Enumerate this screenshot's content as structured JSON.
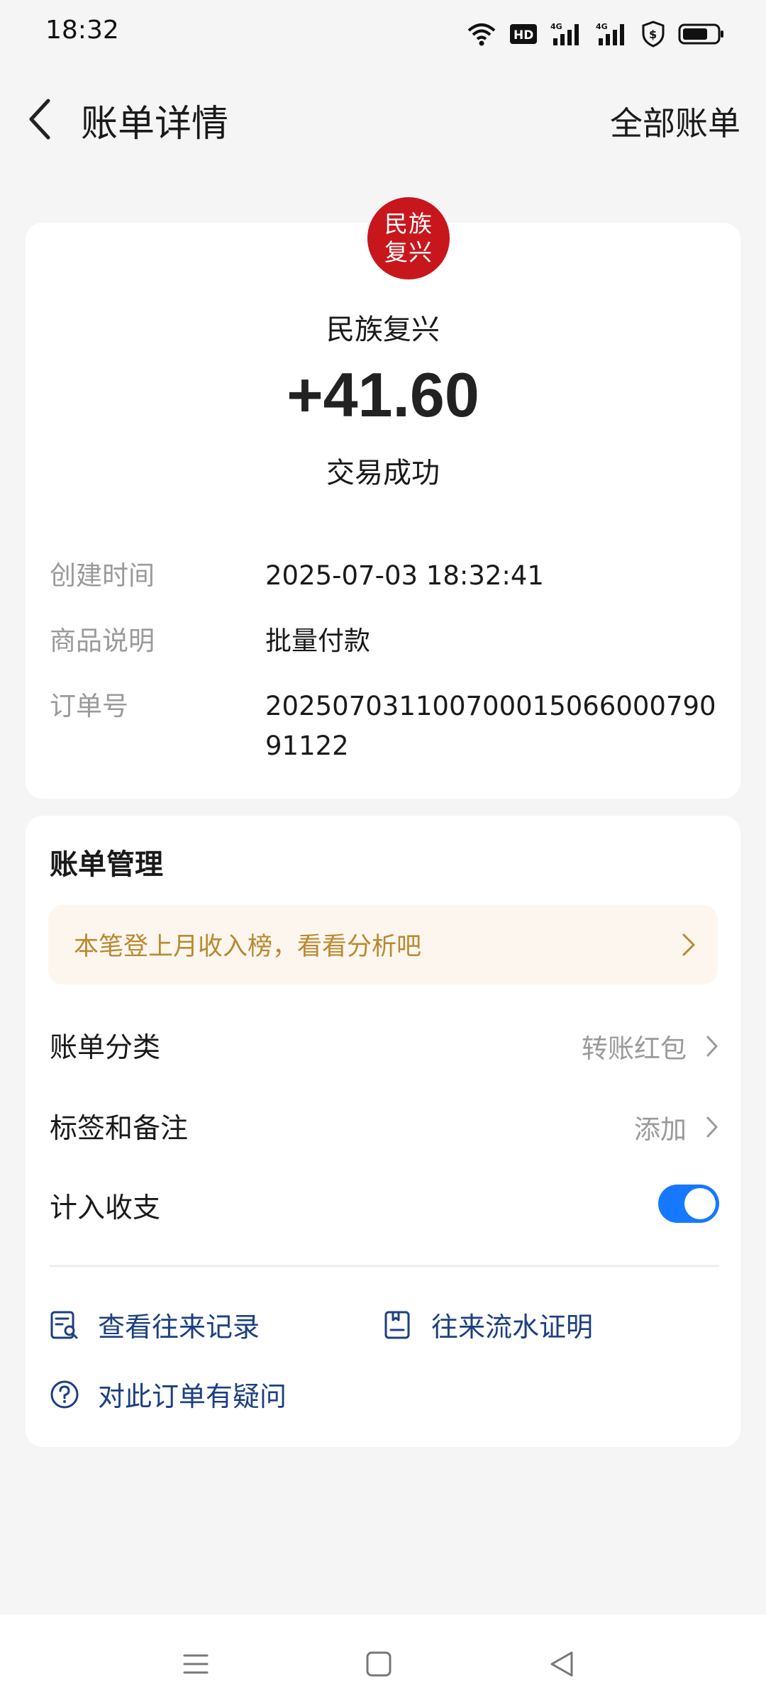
{
  "status_bar": {
    "time": "18:32"
  },
  "header": {
    "title": "账单详情",
    "all_bills": "全部账单"
  },
  "merchant": {
    "logo_text": "民族复兴",
    "name": "民族复兴",
    "logo_color": "#c8161d"
  },
  "transaction": {
    "amount": "+41.60",
    "status": "交易成功"
  },
  "details": [
    {
      "label": "创建时间",
      "value": "2025-07-03 18:32:41"
    },
    {
      "label": "商品说明",
      "value": "批量付款"
    },
    {
      "label": "订单号",
      "value": "20250703110070001506600079091122"
    }
  ],
  "manage": {
    "title": "账单管理",
    "insight_banner": "本笔登上月收入榜，看看分析吧",
    "category_label": "账单分类",
    "category_value": "转账红包",
    "tags_label": "标签和备注",
    "tags_value": "添加",
    "include_label": "计入收支",
    "include_enabled": true,
    "accent_color": "#1677ff"
  },
  "links": {
    "records": "查看往来记录",
    "proof": "往来流水证明",
    "question": "对此订单有疑问"
  },
  "nav": {
    "icons": [
      "menu-icon",
      "home-square-icon",
      "back-triangle-icon"
    ]
  }
}
